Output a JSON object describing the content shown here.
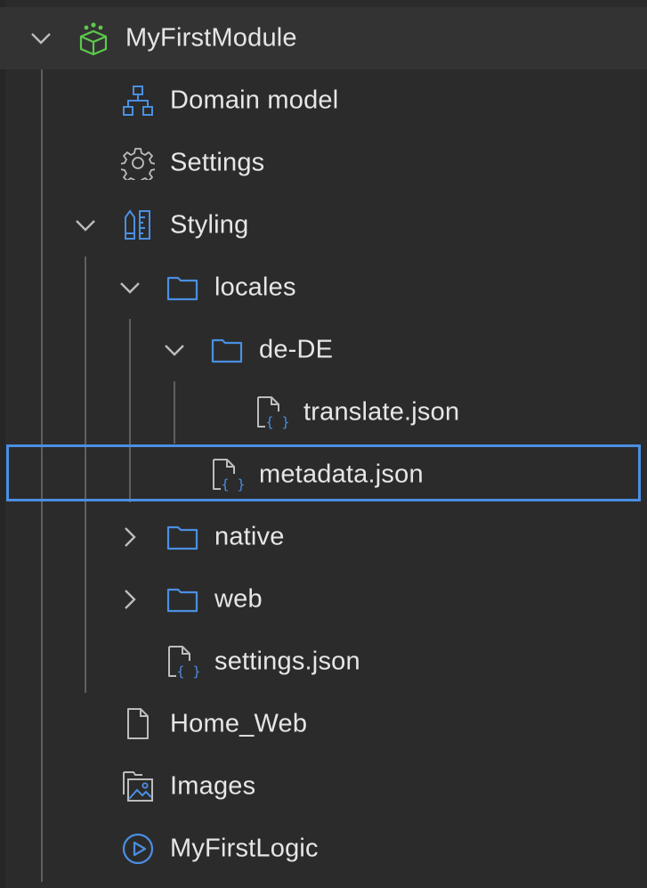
{
  "tree": {
    "root": {
      "label": "MyFirstModule",
      "icon": "module-cube-icon",
      "expanded": true
    },
    "items": [
      {
        "label": "Domain model",
        "icon": "domain-model-icon"
      },
      {
        "label": "Settings",
        "icon": "gear-icon"
      },
      {
        "label": "Styling",
        "icon": "styling-ruler-icon",
        "expanded": true
      },
      {
        "label": "locales",
        "icon": "folder-icon",
        "expanded": true
      },
      {
        "label": "de-DE",
        "icon": "folder-icon",
        "expanded": true
      },
      {
        "label": "translate.json",
        "icon": "json-file-icon"
      },
      {
        "label": "metadata.json",
        "icon": "json-file-icon",
        "selected": true
      },
      {
        "label": "native",
        "icon": "folder-icon",
        "expanded": false
      },
      {
        "label": "web",
        "icon": "folder-icon",
        "expanded": false
      },
      {
        "label": "settings.json",
        "icon": "json-file-icon"
      },
      {
        "label": "Home_Web",
        "icon": "page-file-icon"
      },
      {
        "label": "Images",
        "icon": "images-icon"
      },
      {
        "label": "MyFirstLogic",
        "icon": "microflow-play-icon"
      }
    ]
  },
  "colors": {
    "background": "#2b2b2b",
    "root_background": "#333333",
    "text": "#e6e6e6",
    "accent_blue": "#4a8fe2",
    "module_green": "#5cc94b",
    "icon_gray": "#bdbdbd",
    "guide": "#5f5f5f"
  }
}
